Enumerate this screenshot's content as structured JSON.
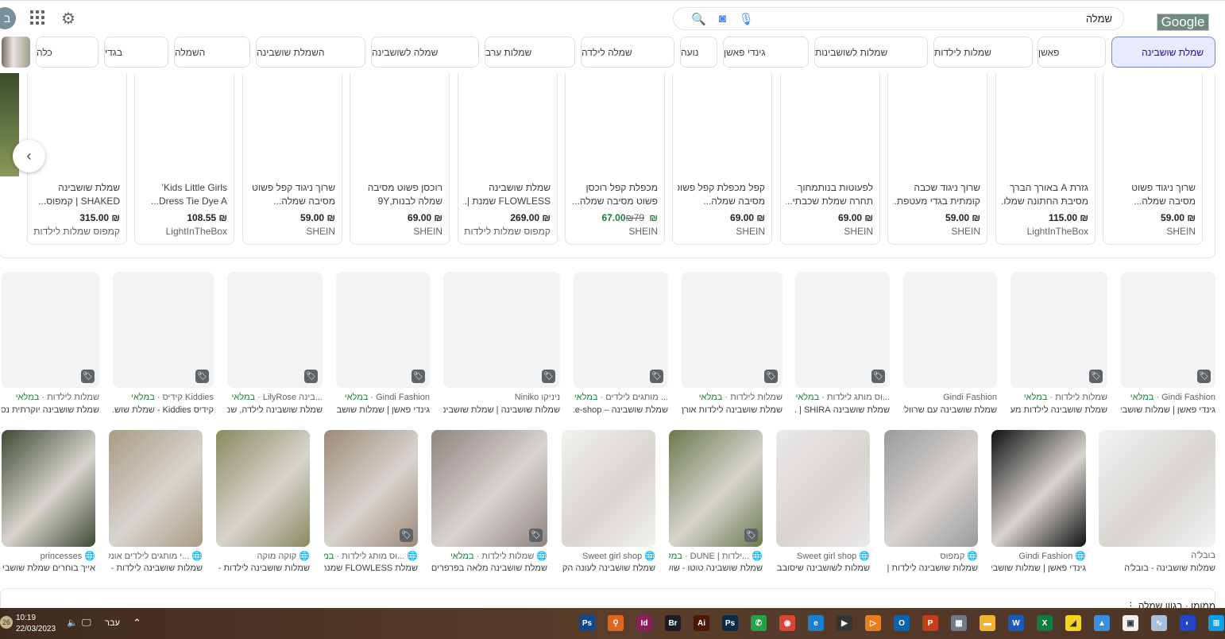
{
  "header": {
    "avatar_letter": "ב",
    "search_query": "שמלה",
    "logo": "Google"
  },
  "chips": [
    "שמלת שושבינה",
    "פאשן",
    "שמלות לילדות",
    "שמלות לשושבינות",
    "גינדי פאשן",
    "נועה",
    "שמלה לילדה",
    "שמלות ערב",
    "שמלה לשושבינה",
    "השמלת שושבינה",
    "השמלה",
    "בגדי",
    "כלה"
  ],
  "products": [
    {
      "title1": "שרוך ניגוד פשוט",
      "title2": "מסיבה שמלה...",
      "price": "₪ 59.00",
      "store": "SHEIN"
    },
    {
      "title1": "גזרת A באורך הברך",
      "title2": "מסיבת החתונה שמלו...",
      "price": "₪ 115.00",
      "store": "LightInTheBox"
    },
    {
      "title1": "שרוך ניגוד שכבה",
      "title2": "קומתית בגדי מעטפת...",
      "price": "₪ 59.00",
      "store": "SHEIN"
    },
    {
      "title1": "לפעוטות בנותמחוך",
      "title2": "תחרה שמלת שכבתי...",
      "price": "₪ 69.00",
      "store": "SHEIN"
    },
    {
      "title1": "קפל מכפלת קפל פשוט",
      "title2": "מסיבה שמלה...",
      "price": "₪ 69.00",
      "store": "SHEIN"
    },
    {
      "title1": "מכפלת קפל רוכסן",
      "title2": "פשוט מסיבה שמלה...",
      "price": "₪ 67.00",
      "old_price": "₪79",
      "store": "SHEIN"
    },
    {
      "title1": "שמלת שושבינה",
      "title2": "FLOWLESS שמנת |...",
      "price": "₪ 269.00",
      "store": "קמפוס שמלות לילדות"
    },
    {
      "title1": "רוכסן פשוט מסיבה",
      "title2": "שמלה לבנות,9Y",
      "price": "₪ 69.00",
      "store": "SHEIN"
    },
    {
      "title1": "שרוך ניגוד קפל פשוט",
      "title2": "מסיבה שמלה...",
      "price": "₪ 59.00",
      "store": "SHEIN"
    },
    {
      "title1": "Kids Little Girls'",
      "title2": "Dress Tie Dye A...",
      "price": "₪ 108.55",
      "store": "LightInTheBox"
    },
    {
      "title1": "שמלת שושבינה",
      "title2": "SHAKED | קמפוס...",
      "price": "₪ 315.00",
      "store": "קמפוס שמלות לילדות"
    }
  ],
  "in_stock_label": "במלאי",
  "row2": [
    {
      "source": "Gindi Fashion",
      "stock": true,
      "title": "גינדי פאשן | שמלות שושבי..."
    },
    {
      "source": "שמלות לילדות",
      "stock": true,
      "title": "שמלת שושבינה לילדות מעו..."
    },
    {
      "source": "Gindi Fashion",
      "stock": false,
      "title": "שמלת שושבינה עם שרוולי..."
    },
    {
      "source": "...וס מותג לילדות",
      "stock": true,
      "title": "שמלת שושבינה SHIRA | ..."
    },
    {
      "source": "שמלות לילדות",
      "stock": true,
      "title": "שמלת שושבינה לילדות אורך..."
    },
    {
      "source": "... מותגים לילדים",
      "stock": true,
      "title": "שמלת שושבינה – e-shop..."
    },
    {
      "source": "ניניקו Niniko",
      "stock": false,
      "title": "שמלות שושבינה | שמלת שושבינה..."
    },
    {
      "source": "Gindi Fashion",
      "stock": true,
      "title": "גינדי פאשן | שמלות שושבי..."
    },
    {
      "source": "...בינה LilyRose",
      "stock": true,
      "title": "שמלת שושבינה לילדה, שמ..."
    },
    {
      "source": "Kiddies קידיס",
      "stock": true,
      "title": "קידיס Kiddies - שמלת שוש..."
    },
    {
      "source": "שמלות לילדות",
      "stock": true,
      "title": "שמלת שושבינה יוקרתית נס..."
    }
  ],
  "row3": [
    {
      "source": "בובל'ה",
      "stock": false,
      "title": "שמלות שושבינה - בובל'ה",
      "globe": false,
      "color": "#f1f3f4"
    },
    {
      "source": "Gindi Fashion",
      "stock": false,
      "title": "גינדי פאשן | שמלות שושבי...",
      "globe": true,
      "color": "#111111"
    },
    {
      "source": "קמפוס",
      "stock": false,
      "title": "שמלות שושבינה לילדות | ...",
      "globe": true,
      "color": "#9a9a9e"
    },
    {
      "source": "Sweet girl shop",
      "stock": false,
      "title": "שמלות לשושבינה שיסובבו ...",
      "globe": true,
      "color": "#ebe9ea"
    },
    {
      "source": "...ילדות | DUNE",
      "stock": true,
      "title": "שמלת שושבינה טוטו - שוש...",
      "globe": true,
      "color": "#6b7a4e"
    },
    {
      "source": "Sweet girl shop",
      "stock": false,
      "title": "שמלת שושבינה לעונה הק...",
      "globe": true,
      "color": "#f3f2ee"
    },
    {
      "source": "שמלות לילדות",
      "stock": true,
      "title": "שמלת שושבינה מלאה בפרפרים ל...",
      "globe": true,
      "color": "#8f8480"
    },
    {
      "source": "...וס מותג לילדות",
      "stock": true,
      "title": "שמלת FLOWLESS שמנת ...",
      "globe": true,
      "color": "#9c8a78"
    },
    {
      "source": "קוקה מוקה",
      "stock": false,
      "title": "שמלות שושבינה לילדות - ...",
      "globe": true,
      "color": "#8a8a5e"
    },
    {
      "source": "...י מותגים לילדים אונליין",
      "stock": false,
      "title": "שמלות שושבינה לילדות - ...",
      "globe": true,
      "color": "#a89c84"
    },
    {
      "source": "princesses",
      "stock": false,
      "title": "אייך בוחרים שמלת שושבינ...",
      "globe": true,
      "color": "#3e4a34"
    }
  ],
  "sponsored": "ממומן · בגוון שמלה ⋮",
  "taskbar": {
    "time": "10:19",
    "date": "22/03/2023",
    "lang": "עבר",
    "badge": "26",
    "apps": [
      {
        "label": "Ps",
        "color": "#0b4a8f"
      },
      {
        "label": "⚲",
        "color": "#e0661d"
      },
      {
        "label": "Id",
        "color": "#8c1f5c"
      },
      {
        "label": "Br",
        "color": "#1d1d28"
      },
      {
        "label": "Ai",
        "color": "#4a1a00"
      },
      {
        "label": "Ps",
        "color": "#0a2a4a"
      },
      {
        "label": "✆",
        "color": "#25a244"
      },
      {
        "label": "◉",
        "color": "#db4437"
      },
      {
        "label": "e",
        "color": "#1a7fd0"
      },
      {
        "label": "▶",
        "color": "#333333"
      },
      {
        "label": "▷",
        "color": "#e67e22"
      },
      {
        "label": "O",
        "color": "#0a64ad"
      },
      {
        "label": "P",
        "color": "#c43e1c"
      },
      {
        "label": "▦",
        "color": "#6d7b8a"
      },
      {
        "label": "▬",
        "color": "#f2b530"
      },
      {
        "label": "W",
        "color": "#185abd"
      },
      {
        "label": "X",
        "color": "#107c41"
      },
      {
        "label": "◢",
        "color": "#f7d31a"
      },
      {
        "label": "▲",
        "color": "#3a8fd8"
      },
      {
        "label": "▣",
        "color": "#f0f0f0"
      },
      {
        "label": "∿",
        "color": "#a8c0d8"
      },
      {
        "label": "◐",
        "color": "#2244cc"
      },
      {
        "label": "⊞",
        "color": "#0a9ee8"
      }
    ]
  }
}
